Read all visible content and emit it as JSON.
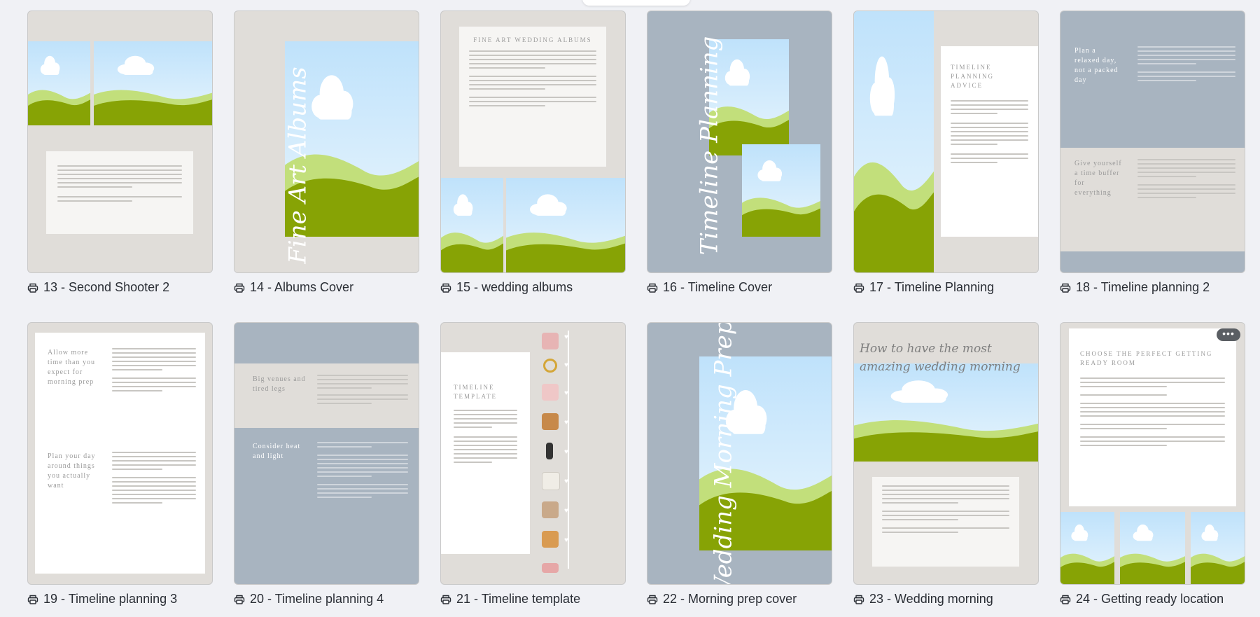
{
  "pages": [
    {
      "label": "13 - Second Shooter 2",
      "print_icon": "print-icon"
    },
    {
      "label": "14 - Albums Cover",
      "print_icon": "print-icon"
    },
    {
      "label": "15 - wedding albums",
      "print_icon": "print-icon"
    },
    {
      "label": "16 - Timeline Cover",
      "print_icon": "print-icon"
    },
    {
      "label": "17 -  Timeline Planning",
      "print_icon": "print-icon"
    },
    {
      "label": "18 - Timeline planning 2",
      "print_icon": "print-icon"
    },
    {
      "label": "19 - Timeline planning 3",
      "print_icon": "print-icon"
    },
    {
      "label": "20 - Timeline planning 4",
      "print_icon": "print-icon"
    },
    {
      "label": "21 - Timeline template",
      "print_icon": "print-icon"
    },
    {
      "label": "22 - Morning prep cover",
      "print_icon": "print-icon"
    },
    {
      "label": "23 - Wedding morning",
      "print_icon": "print-icon"
    },
    {
      "label": "24 - Getting ready location",
      "print_icon": "print-icon"
    }
  ],
  "thumb_text": {
    "p14_script": "Fine Art Albums",
    "p15_title": "FINE ART WEDDING ALBUMS",
    "p16_script": "Timeline Planning",
    "p17_title": "TIMELINE PLANNING ADVICE",
    "p18_item1": "Plan a relaxed day, not a packed day",
    "p18_item2": "Give yourself a time buffer for everything",
    "p19_item3": "Allow more time than you expect for morning prep",
    "p19_item4": "Plan your day around things you actually want",
    "p20_item5": "Big venues and tired legs",
    "p20_item6": "Consider heat and light",
    "p21_title": "TIMELINE TEMPLATE",
    "p22_script": "Wedding Morning Prep",
    "p23_script": "How to have the most amazing wedding morning",
    "p24_title": "CHOOSE THE PERFECT GETTING READY ROOM",
    "more_label": "•••"
  },
  "colors": {
    "beige": "#e0ddd9",
    "blue_grey": "#a8b4c0",
    "sky": "#cfe9fb",
    "grass_light": "#c2df7b",
    "grass_dark": "#87a305",
    "caption_text": "#2a2e35",
    "page_bg": "#f0f1f5"
  }
}
